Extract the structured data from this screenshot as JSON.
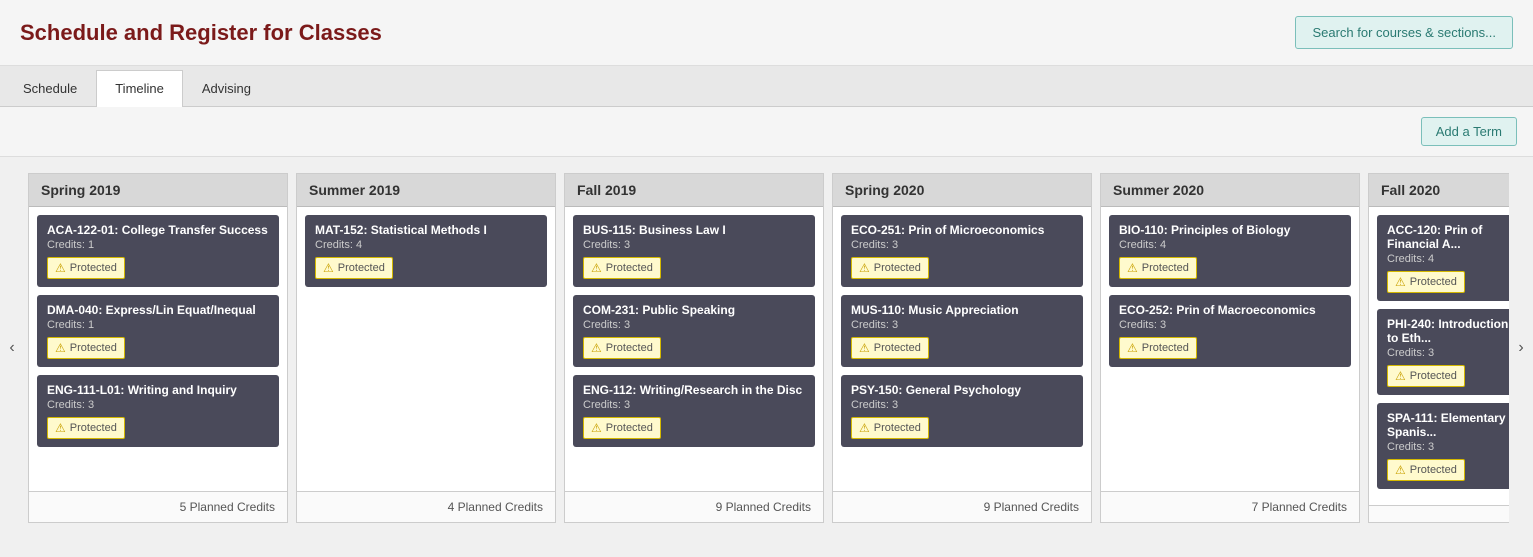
{
  "header": {
    "title": "Schedule and Register for Classes",
    "search_button": "Search for courses & sections..."
  },
  "tabs": [
    {
      "label": "Schedule",
      "active": false
    },
    {
      "label": "Timeline",
      "active": true
    },
    {
      "label": "Advising",
      "active": false
    }
  ],
  "toolbar": {
    "add_term_label": "Add a Term"
  },
  "terms": [
    {
      "id": "spring2019",
      "title": "Spring 2019",
      "courses": [
        {
          "title": "ACA-122-01: College Transfer Success",
          "credits": "Credits: 1",
          "status": "Protected"
        },
        {
          "title": "DMA-040: Express/Lin Equat/Inequal",
          "credits": "Credits: 1",
          "status": "Protected"
        },
        {
          "title": "ENG-111-L01: Writing and Inquiry",
          "credits": "Credits: 3",
          "status": "Protected"
        }
      ],
      "footer": "5 Planned Credits"
    },
    {
      "id": "summer2019",
      "title": "Summer 2019",
      "courses": [
        {
          "title": "MAT-152: Statistical Methods I",
          "credits": "Credits: 4",
          "status": "Protected"
        }
      ],
      "footer": "4 Planned Credits"
    },
    {
      "id": "fall2019",
      "title": "Fall 2019",
      "courses": [
        {
          "title": "BUS-115: Business Law I",
          "credits": "Credits: 3",
          "status": "Protected"
        },
        {
          "title": "COM-231: Public Speaking",
          "credits": "Credits: 3",
          "status": "Protected"
        },
        {
          "title": "ENG-112: Writing/Research in the Disc",
          "credits": "Credits: 3",
          "status": "Protected"
        }
      ],
      "footer": "9 Planned Credits"
    },
    {
      "id": "spring2020",
      "title": "Spring 2020",
      "courses": [
        {
          "title": "ECO-251: Prin of Microeconomics",
          "credits": "Credits: 3",
          "status": "Protected"
        },
        {
          "title": "MUS-110: Music Appreciation",
          "credits": "Credits: 3",
          "status": "Protected"
        },
        {
          "title": "PSY-150: General Psychology",
          "credits": "Credits: 3",
          "status": "Protected"
        }
      ],
      "footer": "9 Planned Credits"
    },
    {
      "id": "summer2020",
      "title": "Summer 2020",
      "courses": [
        {
          "title": "BIO-110: Principles of Biology",
          "credits": "Credits: 4",
          "status": "Protected"
        },
        {
          "title": "ECO-252: Prin of Macroeconomics",
          "credits": "Credits: 3",
          "status": "Protected"
        }
      ],
      "footer": "7 Planned Credits"
    },
    {
      "id": "fall2020",
      "title": "Fall 2020",
      "courses": [
        {
          "title": "ACC-120: Prin of Financial A...",
          "credits": "Credits: 4",
          "status": "Protected"
        },
        {
          "title": "PHI-240: Introduction to Eth...",
          "credits": "Credits: 3",
          "status": "Protected"
        },
        {
          "title": "SPA-111: Elementary Spanis...",
          "credits": "Credits: 3",
          "status": "Protected"
        }
      ],
      "footer": ""
    }
  ],
  "nav": {
    "left_arrow": "‹",
    "right_arrow": "›"
  },
  "status_label": "Protected",
  "warn_symbol": "⚠"
}
